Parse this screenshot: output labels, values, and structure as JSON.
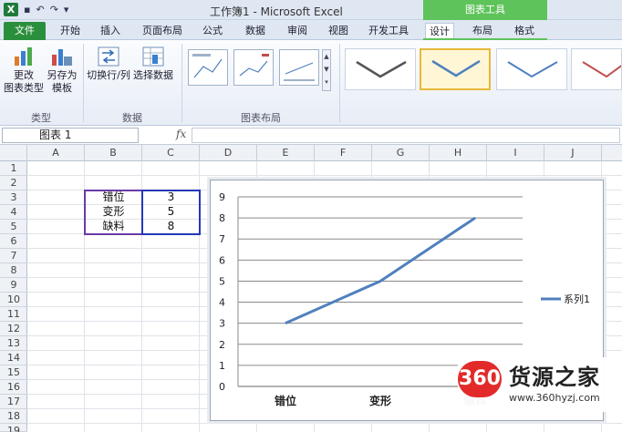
{
  "window": {
    "title": "工作簿1 - Microsoft Excel",
    "context_header": "图表工具",
    "qat_icons": [
      "excel-logo",
      "save-icon",
      "undo-icon",
      "redo-icon",
      "customize-icon"
    ]
  },
  "tabs": [
    "文件",
    "开始",
    "插入",
    "页面布局",
    "公式",
    "数据",
    "审阅",
    "视图",
    "开发工具",
    "设计",
    "布局",
    "格式"
  ],
  "active_tab": "设计",
  "ribbon": {
    "type_group": {
      "label": "类型",
      "change_type": [
        "更改",
        "图表类型"
      ],
      "save_template": [
        "另存为",
        "模板"
      ]
    },
    "data_group": {
      "label": "数据",
      "switch_row_col": "切换行/列",
      "select_data": "选择数据"
    },
    "layout_group": {
      "label": "图表布局"
    },
    "styles": {
      "accent_selected": "#e8b83a"
    }
  },
  "formula_bar": {
    "name_box": "图表 1",
    "fx": "fx",
    "value": ""
  },
  "columns": [
    "A",
    "B",
    "C",
    "D",
    "E",
    "F",
    "G",
    "H",
    "I",
    "J"
  ],
  "rows": [
    "1",
    "2",
    "3",
    "4",
    "5",
    "6",
    "7",
    "8",
    "9",
    "10",
    "11",
    "12",
    "13",
    "14",
    "15",
    "16",
    "17",
    "18",
    "19"
  ],
  "sheet_cells": {
    "B3": "错位",
    "C3": "3",
    "B4": "变形",
    "C4": "5",
    "B5": "缺料",
    "C5": "8"
  },
  "chart_data": {
    "type": "line",
    "categories": [
      "错位",
      "变形",
      "缺料"
    ],
    "series": [
      {
        "name": "系列1",
        "values": [
          3,
          5,
          8
        ],
        "color": "#4f81bd"
      }
    ],
    "ylim": [
      0,
      9
    ],
    "yticks": [
      "0",
      "1",
      "2",
      "3",
      "4",
      "5",
      "6",
      "7",
      "8",
      "9"
    ],
    "grid": true,
    "legend": "right",
    "title": "",
    "xlabel": "",
    "ylabel": ""
  },
  "watermark": {
    "logo": "360",
    "name": "货源之家",
    "url": "www.360hyzj.com"
  }
}
